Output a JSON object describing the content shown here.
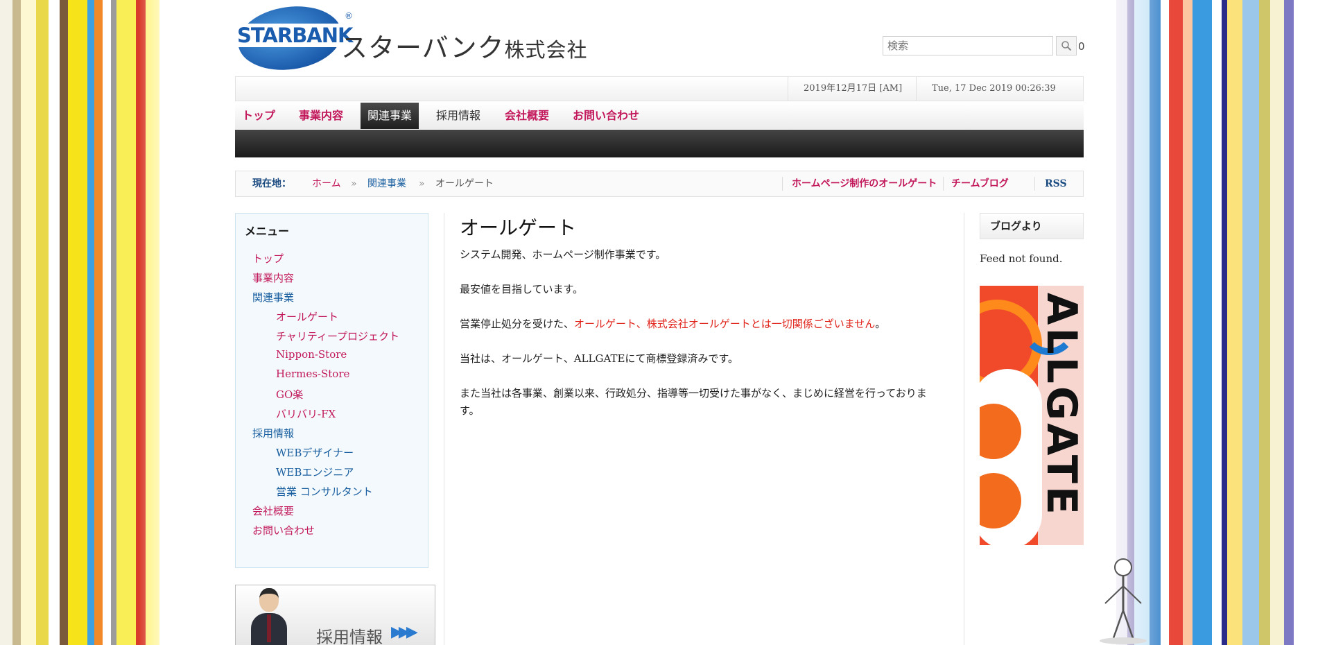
{
  "header": {
    "logo_word": "STARBANK",
    "logo_reg": "®",
    "logo_company": "スターバンク",
    "logo_company_suffix": "株式会社",
    "search_placeholder": "検索",
    "search_count": "0"
  },
  "datebar": {
    "date_jp": "2019年12月17日 [AM]",
    "date_en": "Tue, 17 Dec 2019 00:26:39 +0000"
  },
  "nav": {
    "items": [
      "トップ",
      "事業内容",
      "関連事業",
      "採用情報",
      "会社概要",
      "お問い合わせ"
    ],
    "active": "関連事業"
  },
  "breadcrumb": {
    "label": "現在地：",
    "home": "ホーム",
    "sep": "»",
    "parent": "関連事業",
    "current": "オールゲート",
    "right_links": [
      "ホームページ制作のオールゲート",
      "チームブログ",
      "RSS"
    ]
  },
  "sidebar": {
    "title": "メニュー",
    "items": [
      {
        "label": "トップ"
      },
      {
        "label": "事業内容"
      },
      {
        "label": "関連事業"
      },
      {
        "label": "オールゲート"
      },
      {
        "label": "チャリティープロジェクト"
      },
      {
        "label": "Nippon-Store"
      },
      {
        "label": "Hermes-Store"
      },
      {
        "label": "GO楽"
      },
      {
        "label": "バリバリ-FX"
      },
      {
        "label": "採用情報"
      },
      {
        "label": "WEBデザイナー"
      },
      {
        "label": "WEBエンジニア"
      },
      {
        "label": "営業 コンサルタント"
      },
      {
        "label": "会社概要"
      },
      {
        "label": "お問い合わせ"
      }
    ],
    "banner_text": "採用情報",
    "banner_arrows": "▶▶▶"
  },
  "main": {
    "title": "オールゲート",
    "p1": "システム開発、ホームページ制作事業です。",
    "p2": "最安値を目指しています。",
    "p3_pre": "営業停止処分を受けた、",
    "p3_red": "オールゲート、株式会社オールゲートとは一切関係ございません",
    "p3_post": "。",
    "p4": "当社は、オールゲート、ALLGATEにて商標登録済みです。",
    "p5": "また当社は各事業、創業以来、行政処分、指導等一切受けた事がなく、まじめに経営を行っております。"
  },
  "right": {
    "blog_title": "ブログより",
    "feed_text": "Feed not found.",
    "ad_word": "ALLGATE"
  },
  "colors": {
    "accent_pink": "#c2185b",
    "link_blue": "#1a5fa0",
    "warning_red": "#e0241b",
    "logo_blue": "#1a5cae"
  }
}
